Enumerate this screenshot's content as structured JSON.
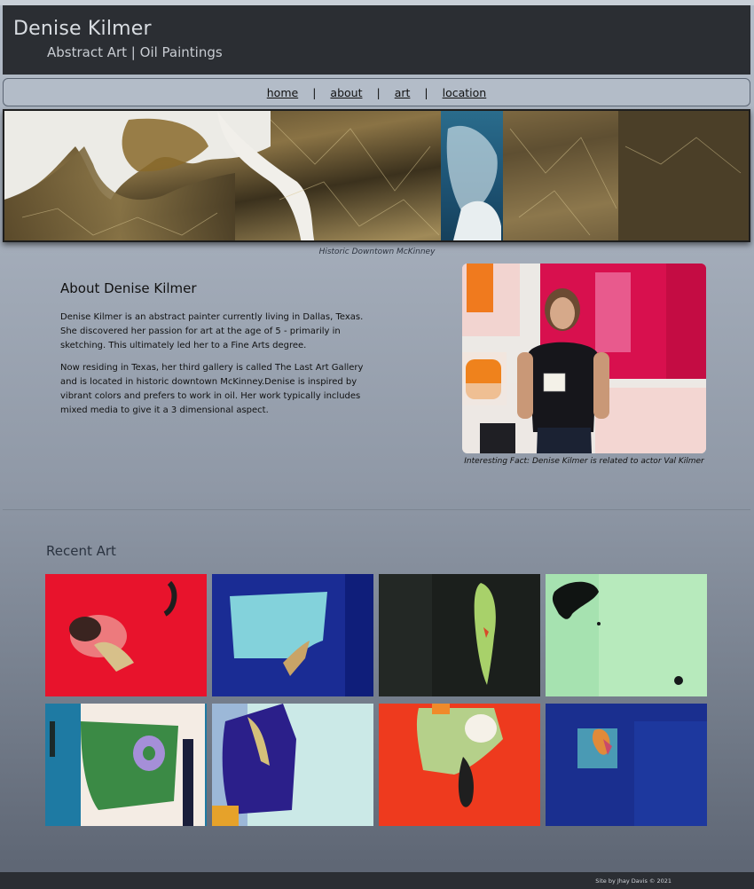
{
  "header": {
    "title": "Denise Kilmer",
    "subtitle": "Abstract Art | Oil Paintings"
  },
  "nav": {
    "items": [
      "home",
      "about",
      "art",
      "location"
    ],
    "separator": "|"
  },
  "hero": {
    "caption": "Historic Downtown McKinney"
  },
  "about": {
    "heading": "About Denise Kilmer",
    "paragraph_1": "Denise Kilmer is an abstract painter currently living in Dallas, Texas. She discovered her passion for art at the age of 5 - primarily in sketching. This ultimately led her to a Fine Arts degree.",
    "paragraph_2": "Now residing in Texas, her third gallery is called The Last Art Gallery and is located in historic downtown McKinney.Denise is inspired by vibrant colors and prefers to work in oil. Her work typically includes mixed media to give it a 3 dimensional aspect.",
    "photo_caption": "Interesting Fact: Denise Kilmer is related to actor Val Kilmer"
  },
  "recent": {
    "heading": "Recent Art",
    "artworks": 8
  },
  "footer": {
    "credit": "Site by Jhay Davis © 2021"
  },
  "colors": {
    "header_bg": "#2b2e33",
    "nav_bg": "#b3bcc8",
    "page_gradient_top": "#b4bdc9",
    "page_gradient_bottom": "#5f6775"
  }
}
